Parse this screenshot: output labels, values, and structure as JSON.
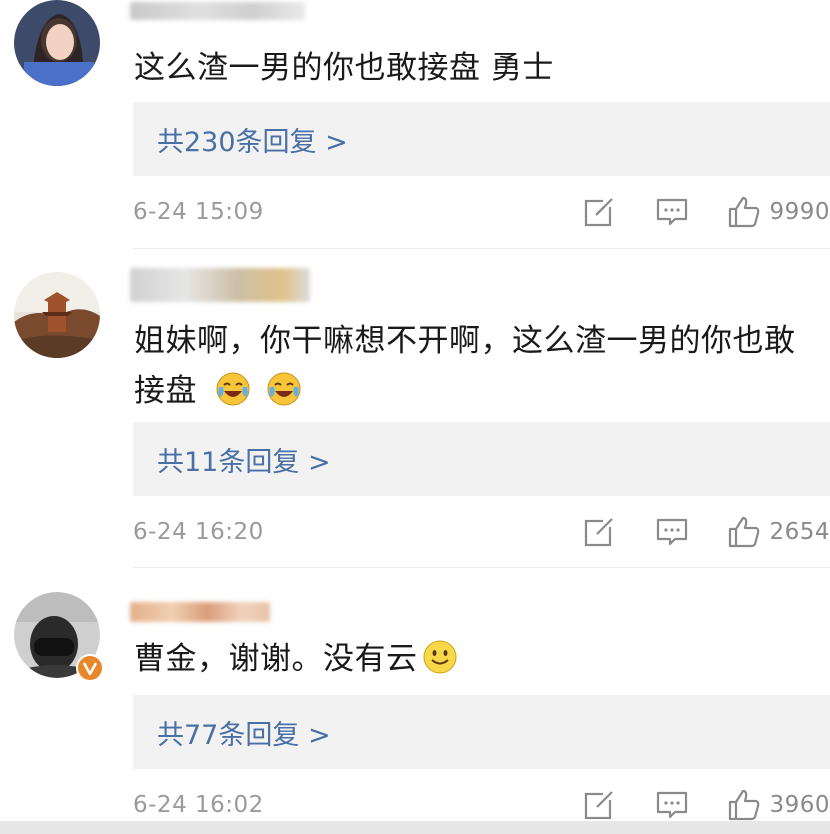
{
  "comments": [
    {
      "text": "这么渣一男的你也敢接盘  勇士",
      "replies": "共230条回复 >",
      "time": "6-24 15:09",
      "likes": "9990"
    },
    {
      "text": "姐妹啊，你干嘛想不开啊，这么渣一男的你也敢接盘",
      "replies": "共11条回复 >",
      "time": "6-24 16:20",
      "likes": "2654"
    },
    {
      "text": "曹金，谢谢。没有云",
      "replies": "共77条回复 >",
      "time": "6-24 16:02",
      "likes": "3960"
    }
  ],
  "icons": {
    "share": "share-icon",
    "comment": "comment-icon",
    "like": "thumbs-up-icon",
    "cry_laugh": "laughing-crying-emoji",
    "smile": "smile-emoji",
    "verified": "verified-badge-icon"
  },
  "colors": {
    "reply_link": "#4a6fa5",
    "reply_bg": "#f2f2f2",
    "meta_text": "#9a9a9a",
    "verified_badge": "#e8862a"
  }
}
